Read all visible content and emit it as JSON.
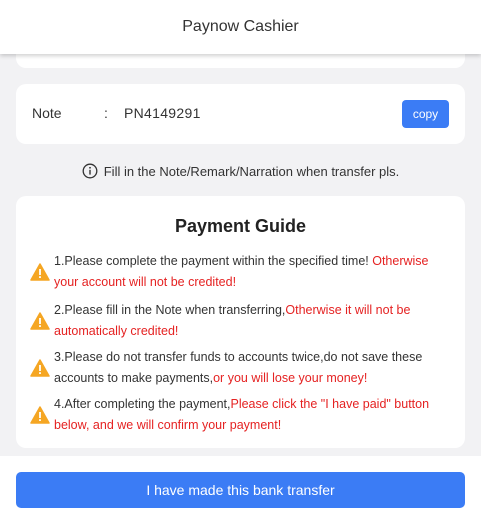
{
  "header": {
    "title": "Paynow Cashier"
  },
  "note": {
    "label": "Note",
    "colon": ":",
    "value": "PN4149291",
    "copy_label": "copy"
  },
  "hint": {
    "text": "Fill in the Note/Remark/Narration when transfer pls."
  },
  "guide": {
    "title": "Payment Guide",
    "items": [
      {
        "normal": "1.Please complete the payment within the specified time! ",
        "red": "Otherwise your account will not be credited!"
      },
      {
        "normal": "2.Please fill in the Note when transferring,",
        "red": "Otherwise it will not be automatically credited!"
      },
      {
        "normal": "3.Please do not transfer funds to accounts twice,do not save these accounts to make payments,",
        "red": "or you will lose your money!"
      },
      {
        "normal": "4.After completing the payment,",
        "red": "Please click the \"I have paid\" button below, and we will confirm your payment!"
      }
    ]
  },
  "submit": {
    "label": "I have made this bank transfer"
  },
  "colors": {
    "accent": "#3b7cf5",
    "warning": "#f5a623",
    "alert_text": "#e52222"
  },
  "icons": {
    "hint": "info-circle-icon",
    "guide_item": "warning-triangle-icon"
  }
}
